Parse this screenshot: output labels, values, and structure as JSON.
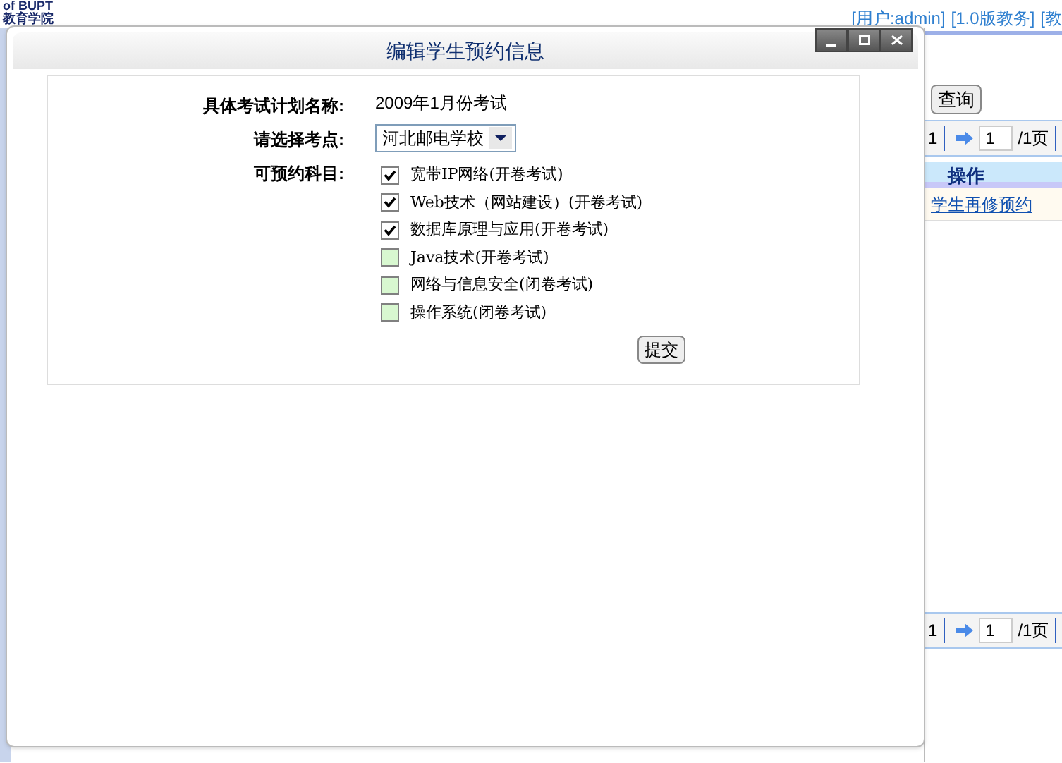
{
  "header": {
    "logo_lines": [
      "of BUPT",
      "教育学院"
    ],
    "user_links": [
      "[用户:admin]",
      "[1.0版教务]",
      "[教"
    ]
  },
  "background_panel": {
    "query_button": "查询",
    "pagers": [
      {
        "page_count": "1",
        "page_input": "1",
        "total": "/1页"
      },
      {
        "page_count": "1",
        "page_input": "1",
        "total": "/1页"
      }
    ],
    "table": {
      "columns": [
        "操作"
      ],
      "rows": [
        {
          "action": "学生再修预约"
        }
      ]
    }
  },
  "dialog": {
    "title": "编辑学生预约信息",
    "fields": [
      {
        "kind": "text",
        "label": "具体考试计划名称:",
        "value": "2009年1月份考试"
      },
      {
        "kind": "select",
        "label": "请选择考点:",
        "value": "河北邮电学校"
      },
      {
        "kind": "checklist",
        "label": "可预约科目:",
        "options": [
          {
            "label": "宽带IP网络(开卷考试)",
            "checked": true
          },
          {
            "label": "Web技术（网站建设）(开卷考试)",
            "checked": true
          },
          {
            "label": "数据库原理与应用(开卷考试)",
            "checked": true
          },
          {
            "label": "Java技术(开卷考试)",
            "checked": false
          },
          {
            "label": "网络与信息安全(闭卷考试)",
            "checked": false
          },
          {
            "label": "操作系统(闭卷考试)",
            "checked": false
          }
        ]
      }
    ],
    "submit": "提交"
  }
}
